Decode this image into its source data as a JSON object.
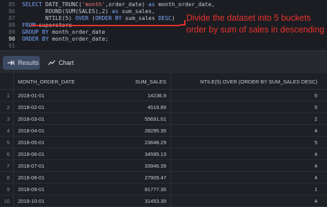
{
  "editor": {
    "line_numbers": [
      "85",
      "86",
      "87",
      "88",
      "89",
      "90",
      "91"
    ],
    "active_line": "90",
    "lines": [
      [
        [
          "kw",
          "SELECT "
        ],
        [
          "",
          "DATE_TRUNC("
        ],
        [
          "str",
          "'month'"
        ],
        [
          "",
          ",order_date) "
        ],
        [
          "kw",
          "as"
        ],
        [
          "",
          " month_order_date,"
        ]
      ],
      [
        [
          "",
          "       ROUND(SUM(SALES),2) "
        ],
        [
          "kw",
          "as"
        ],
        [
          "",
          " sum_sales,"
        ]
      ],
      [
        [
          "",
          "       NTILE(5) "
        ],
        [
          "kw",
          "OVER"
        ],
        [
          "",
          " ("
        ],
        [
          "kw",
          "ORDER BY"
        ],
        [
          "",
          " sum_sales "
        ],
        [
          "kw",
          "DESC"
        ],
        [
          "",
          ")"
        ]
      ],
      [
        [
          "kw",
          "FROM"
        ],
        [
          "",
          " superstore"
        ]
      ],
      [
        [
          "kw",
          "GROUP BY"
        ],
        [
          "",
          " month_order_date"
        ]
      ],
      [
        [
          "kw",
          "ORDER BY"
        ],
        [
          "",
          " month_order_date;"
        ]
      ],
      [
        [
          "",
          ""
        ]
      ]
    ],
    "callout_line1": "Divide the dataset into 5 buckets",
    "callout_line2": "order by sum of sales in descending",
    "callout_color": "#e8322c"
  },
  "toolbar": {
    "results_label": "Results",
    "chart_label": "Chart",
    "results_icon": "arrow-icon",
    "chart_icon": "chart-line-icon"
  },
  "table": {
    "columns": [
      "MONTH_ORDER_DATE",
      "SUM_SALES",
      "NTILE(5) OVER (ORDER BY SUM_SALES DESC)"
    ],
    "rows": [
      {
        "idx": "1",
        "month": "2018-01-01",
        "sales": "14236.9",
        "ntile": "5"
      },
      {
        "idx": "2",
        "month": "2018-02-01",
        "sales": "4519.89",
        "ntile": "5"
      },
      {
        "idx": "3",
        "month": "2018-03-01",
        "sales": "55691.01",
        "ntile": "2"
      },
      {
        "idx": "4",
        "month": "2018-04-01",
        "sales": "28295.35",
        "ntile": "4"
      },
      {
        "idx": "5",
        "month": "2018-05-01",
        "sales": "23648.29",
        "ntile": "5"
      },
      {
        "idx": "6",
        "month": "2018-06-01",
        "sales": "34595.13",
        "ntile": "4"
      },
      {
        "idx": "7",
        "month": "2018-07-01",
        "sales": "33946.39",
        "ntile": "4"
      },
      {
        "idx": "8",
        "month": "2018-08-01",
        "sales": "27909.47",
        "ntile": "4"
      },
      {
        "idx": "9",
        "month": "2018-09-01",
        "sales": "81777.35",
        "ntile": "1"
      },
      {
        "idx": "10",
        "month": "2018-10-01",
        "sales": "31453.39",
        "ntile": "4"
      }
    ]
  }
}
